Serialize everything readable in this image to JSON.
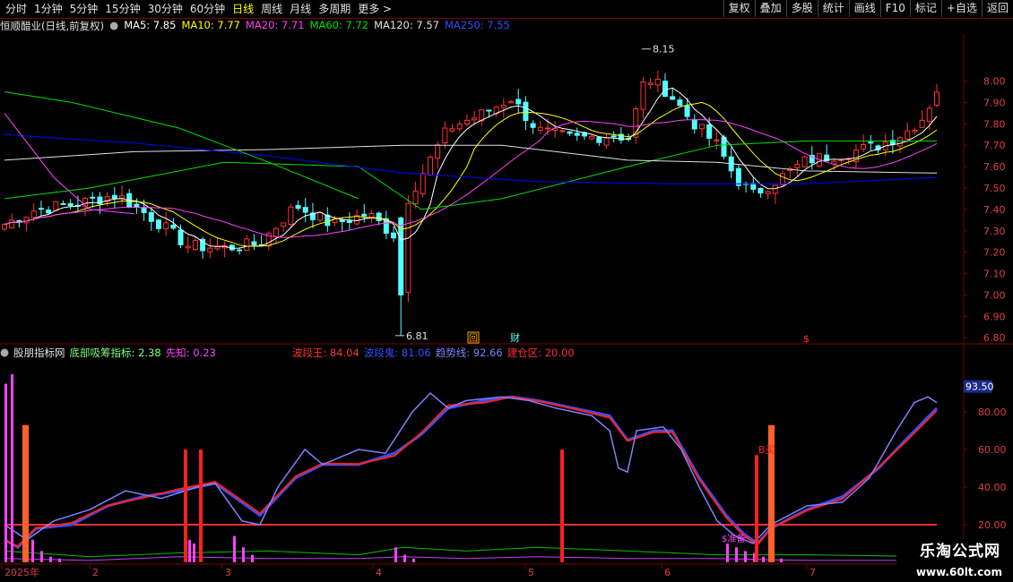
{
  "toolbar": {
    "tabs": [
      "分时",
      "1分钟",
      "5分钟",
      "15分钟",
      "30分钟",
      "60分钟",
      "日线",
      "周线",
      "月线",
      "多周期",
      "更多 >"
    ],
    "active_tab": "日线",
    "buttons": [
      "复权",
      "叠加",
      "多股",
      "统计",
      "画线",
      "F10",
      "标记",
      "+自选",
      "返回"
    ]
  },
  "main_legend": {
    "title": "恒顺醋业(日线,前复权)",
    "ma5": "MA5: 7.85",
    "ma10": "MA10: 7.77",
    "ma20": "MA20: 7.71",
    "ma60": "MA60: 7.72",
    "ma120": "MA120: 7.57",
    "ma250": "MA250: 7.55"
  },
  "sub_legend": {
    "title": "股朋指标网",
    "ind1": "底部吸筹指标: 2.38",
    "ind2": "先知: 0.23",
    "ind3": "波段王: 84.04",
    "ind4": "波段鬼: 81.06",
    "ind5": "趋势线: 92.66",
    "ind6": "建仓区: 20.00"
  },
  "colors": {
    "up": "#ff3232",
    "down": "#54ffff",
    "ma5": "#ffffff",
    "ma10": "#ffff00",
    "ma20": "#ff40ff",
    "ma60": "#00e000",
    "ma120": "#e0e0e0",
    "ma250": "#0000ff",
    "grid_red": "#7a0000"
  },
  "price_axis": [
    "8.00",
    "7.90",
    "7.80",
    "7.70",
    "7.60",
    "7.50",
    "7.40",
    "7.30",
    "7.20",
    "7.10",
    "7.00",
    "6.90",
    "6.80"
  ],
  "sub_axis": [
    "80.00",
    "60.00",
    "40.00",
    "20.00"
  ],
  "sub_current": "93.50",
  "price_high_label": "8.15",
  "price_low_label": "6.81",
  "date_axis": [
    "2025年",
    "2",
    "3",
    "4",
    "5",
    "6",
    "7"
  ],
  "markers": {
    "hui": "回",
    "cai": "财",
    "dollar": "$"
  },
  "sub_annotations": {
    "buy": "B买",
    "near_bottom": "$准备"
  },
  "chart_data": {
    "type": "candlestick",
    "price_range": [
      6.78,
      8.22
    ],
    "indicator_range": [
      0,
      100
    ],
    "high": 8.15,
    "low": 6.81,
    "last_close": 7.96
  },
  "watermark": {
    "title": "乐淘公式网",
    "url": "www.60lt.com"
  }
}
